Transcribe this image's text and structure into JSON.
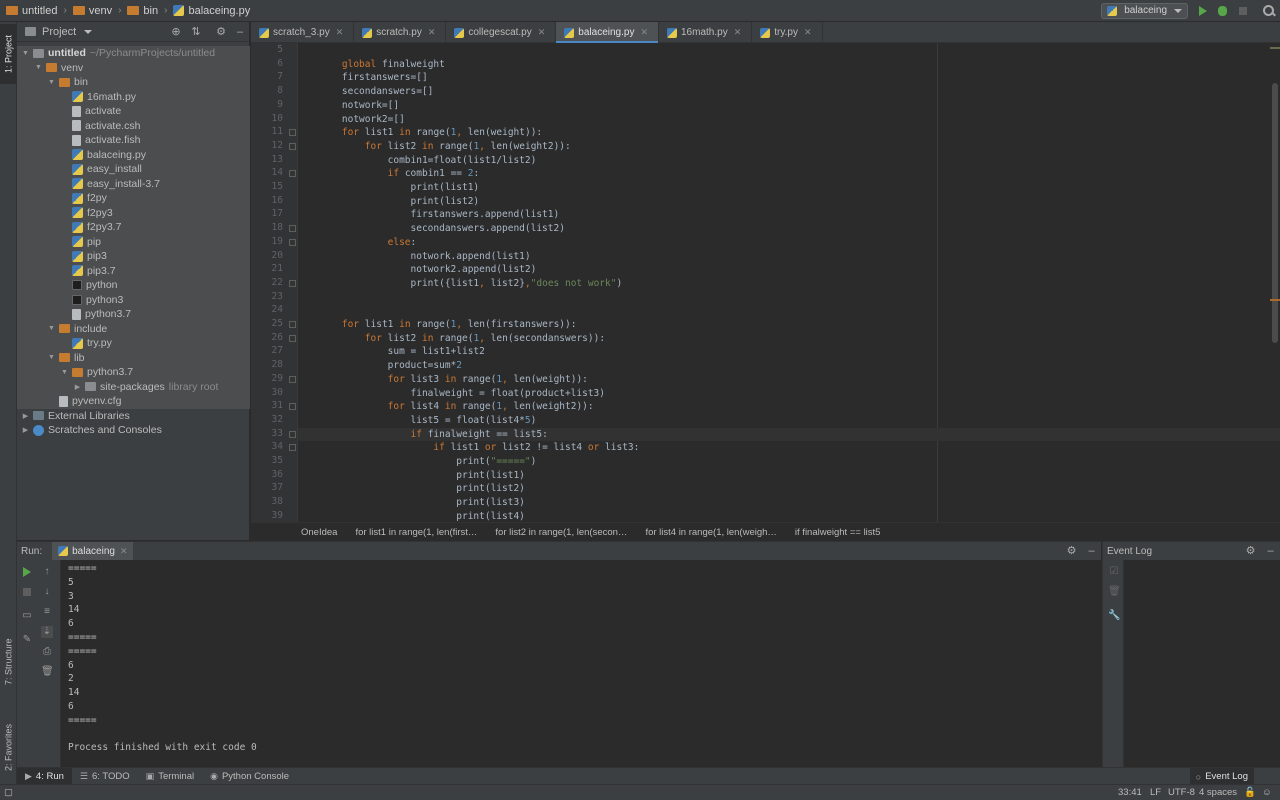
{
  "navbar": {
    "crumbs": [
      "untitled",
      "venv",
      "bin",
      "balaceing.py"
    ],
    "run_config": "balaceing"
  },
  "left_strip": {
    "project_tab": "1: Project",
    "structure_tab": "7: Structure",
    "favorites_tab": "2: Favorites"
  },
  "project_panel": {
    "title": "Project",
    "tree": [
      {
        "label": "untitled",
        "suffix": "~/PycharmProjects/untitled",
        "depth": 0,
        "icon": "folder-grey",
        "arrow": "down",
        "bold": true
      },
      {
        "label": "venv",
        "depth": 1,
        "icon": "folder",
        "arrow": "down"
      },
      {
        "label": "bin",
        "depth": 2,
        "icon": "folder",
        "arrow": "down"
      },
      {
        "label": "16math.py",
        "depth": 3,
        "icon": "py"
      },
      {
        "label": "activate",
        "depth": 3,
        "icon": "file"
      },
      {
        "label": "activate.csh",
        "depth": 3,
        "icon": "file"
      },
      {
        "label": "activate.fish",
        "depth": 3,
        "icon": "file"
      },
      {
        "label": "balaceing.py",
        "depth": 3,
        "icon": "py"
      },
      {
        "label": "easy_install",
        "depth": 3,
        "icon": "py"
      },
      {
        "label": "easy_install-3.7",
        "depth": 3,
        "icon": "py"
      },
      {
        "label": "f2py",
        "depth": 3,
        "icon": "py"
      },
      {
        "label": "f2py3",
        "depth": 3,
        "icon": "py"
      },
      {
        "label": "f2py3.7",
        "depth": 3,
        "icon": "py"
      },
      {
        "label": "pip",
        "depth": 3,
        "icon": "py"
      },
      {
        "label": "pip3",
        "depth": 3,
        "icon": "py"
      },
      {
        "label": "pip3.7",
        "depth": 3,
        "icon": "py"
      },
      {
        "label": "python",
        "depth": 3,
        "icon": "term"
      },
      {
        "label": "python3",
        "depth": 3,
        "icon": "term"
      },
      {
        "label": "python3.7",
        "depth": 3,
        "icon": "file"
      },
      {
        "label": "include",
        "depth": 2,
        "icon": "folder",
        "arrow": "down"
      },
      {
        "label": "try.py",
        "depth": 3,
        "icon": "py"
      },
      {
        "label": "lib",
        "depth": 2,
        "icon": "folder",
        "arrow": "down"
      },
      {
        "label": "python3.7",
        "depth": 3,
        "icon": "folder",
        "arrow": "down"
      },
      {
        "label": "site-packages",
        "suffix": "library root",
        "depth": 4,
        "icon": "folder-grey",
        "arrow": "right"
      },
      {
        "label": "pyvenv.cfg",
        "depth": 2,
        "icon": "file"
      },
      {
        "label": "External Libraries",
        "depth": 0,
        "icon": "lib",
        "arrow": "right"
      },
      {
        "label": "Scratches and Consoles",
        "depth": 0,
        "icon": "scratch",
        "arrow": "right"
      }
    ]
  },
  "tabs": [
    {
      "label": "scratch_3.py",
      "active": false
    },
    {
      "label": "scratch.py",
      "active": false
    },
    {
      "label": "collegescat.py",
      "active": false
    },
    {
      "label": "balaceing.py",
      "active": true
    },
    {
      "label": "16math.py",
      "active": false
    },
    {
      "label": "try.py",
      "active": false
    }
  ],
  "editor": {
    "first_line": 5,
    "current_line": 33,
    "lines": [
      "",
      "    global finalweight",
      "    firstanswers=[]",
      "    secondanswers=[]",
      "    notwork=[]",
      "    notwork2=[]",
      "    for list1 in range(1, len(weight)):",
      "        for list2 in range(1, len(weight2)):",
      "            combin1=float(list1/list2)",
      "            if combin1 == 2:",
      "                print(list1)",
      "                print(list2)",
      "                firstanswers.append(list1)",
      "                secondanswers.append(list2)",
      "            else:",
      "                notwork.append(list1)",
      "                notwork2.append(list2)",
      "                print({list1, list2},\"does not work\")",
      "",
      "",
      "    for list1 in range(1, len(firstanswers)):",
      "        for list2 in range(1, len(secondanswers)):",
      "            sum = list1+list2",
      "            product=sum*2",
      "            for list3 in range(1, len(weight)):",
      "                finalweight = float(product+list3)",
      "            for list4 in range(1, len(weight2)):",
      "                list5 = float(list4*5)",
      "                if finalweight == list5:",
      "                    if list1 or list2 != list4 or list3:",
      "                        print(\"=====\")",
      "                        print(list1)",
      "                        print(list2)",
      "                        print(list3)",
      "                        print(list4)"
    ]
  },
  "editor_breadcrumb": [
    "OneIdea",
    "for list1 in range(1, len(first…",
    "for list2 in range(1, len(secon…",
    "for list4 in range(1, len(weigh…",
    "if finalweight == list5"
  ],
  "run_panel": {
    "title": "Run:",
    "tab": "balaceing",
    "output": [
      "=====",
      "5",
      "3",
      "14",
      "6",
      "=====",
      "=====",
      "6",
      "2",
      "14",
      "6",
      "=====",
      "",
      "Process finished with exit code 0"
    ]
  },
  "event_log": {
    "title": "Event Log"
  },
  "bottom_bar": {
    "run": "4: Run",
    "todo": "6: TODO",
    "terminal": "Terminal",
    "python_console": "Python Console",
    "event_log": "Event Log"
  },
  "status_bar": {
    "position": "33:41",
    "line_sep": "LF",
    "encoding": "UTF-8",
    "indent": "4 spaces"
  }
}
